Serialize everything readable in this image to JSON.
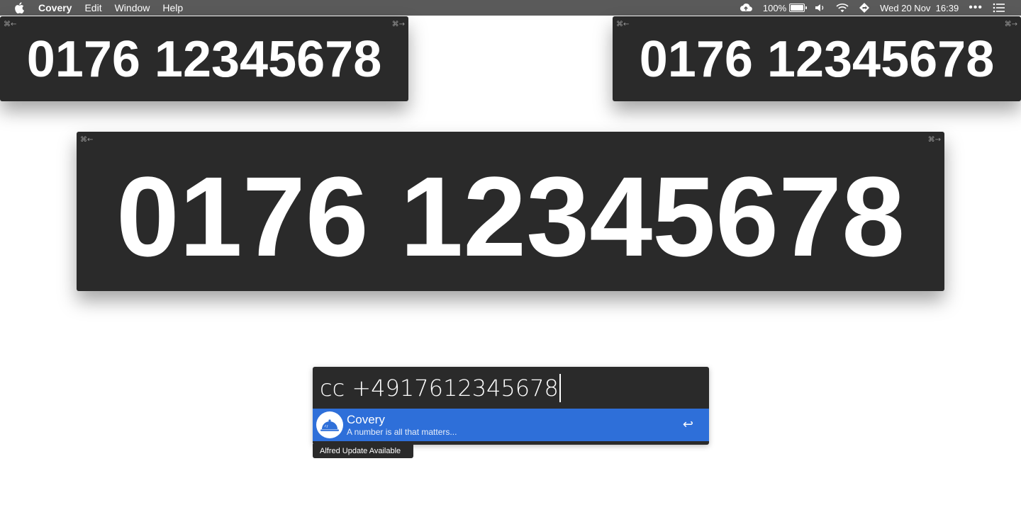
{
  "menubar": {
    "app_name": "Covery",
    "menus": [
      "Edit",
      "Window",
      "Help"
    ],
    "battery_percent": "100%",
    "datetime": "Wed 20 Nov  16:39"
  },
  "panels": {
    "top_left": {
      "number": "0176 12345678",
      "hint_left": "⌘←",
      "hint_right": "⌘→"
    },
    "top_right": {
      "number": "0176 12345678",
      "hint_left": "⌘←",
      "hint_right": "⌘→"
    },
    "main": {
      "number": "0176 12345678",
      "hint_left": "⌘←",
      "hint_right": "⌘→"
    }
  },
  "alfred": {
    "query": "cc +4917612345678",
    "result": {
      "title": "Covery",
      "subtitle": "A number is all that matters...",
      "enter_symbol": "↩",
      "icon": "cloche-icon"
    },
    "update_notice": "Alfred Update Available"
  },
  "colors": {
    "menubar": "#5a5a5a",
    "panel": "#2a2a2a",
    "selection": "#2e6fd9"
  }
}
